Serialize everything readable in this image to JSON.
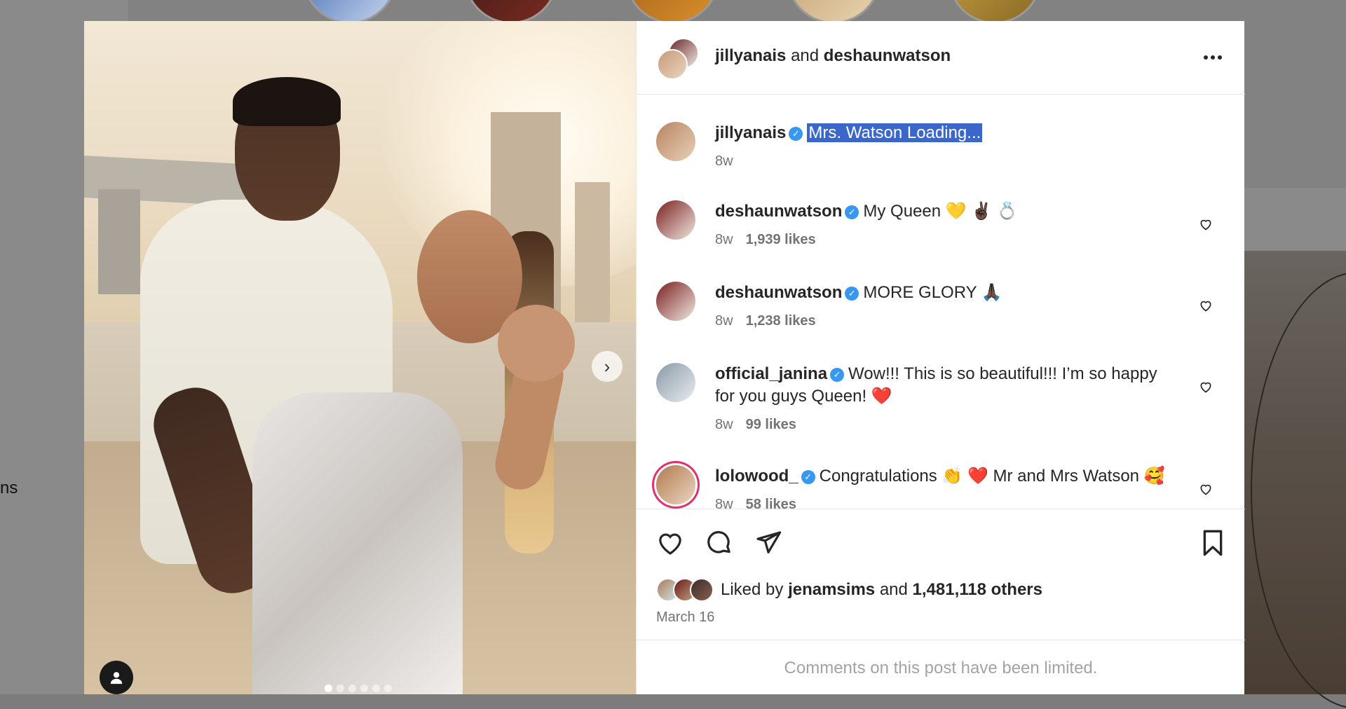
{
  "background": {
    "side_text": "ns"
  },
  "post": {
    "header": {
      "user1": "jillyanais",
      "connector": "and",
      "user2": "deshaunwatson",
      "more_icon": "more-horizontal-icon"
    },
    "caption": {
      "user": "jillyanais",
      "text": "Mrs. Watson Loading...",
      "time": "8w"
    },
    "comments": [
      {
        "user": "deshaunwatson",
        "text": "My Queen 💛 ✌🏿 💍",
        "time": "8w",
        "likes": "1,939 likes",
        "verified": true
      },
      {
        "user": "deshaunwatson",
        "text": "MORE GLORY 🙏🏿",
        "time": "8w",
        "likes": "1,238 likes",
        "verified": true
      },
      {
        "user": "official_janina",
        "text": "Wow!!! This is so beautiful!!! I’m so happy for you guys Queen! ❤️",
        "time": "8w",
        "likes": "99 likes",
        "verified": true
      },
      {
        "user": "lolowood_",
        "text": "Congratulations 👏 ❤️ Mr and Mrs Watson 🥰",
        "time": "8w",
        "likes": "58 likes",
        "verified": true
      }
    ],
    "liked_by": {
      "prefix": "Liked by",
      "user": "jenamsims",
      "connector": "and",
      "others": "1,481,118 others"
    },
    "date": "March 16",
    "comments_limited": "Comments on this post have been limited.",
    "carousel": {
      "count": 6,
      "active_index": 0
    },
    "colors": {
      "verified": "#3897f0",
      "highlight": "#3a67c9",
      "text": "#262626",
      "muted": "#737373"
    }
  }
}
